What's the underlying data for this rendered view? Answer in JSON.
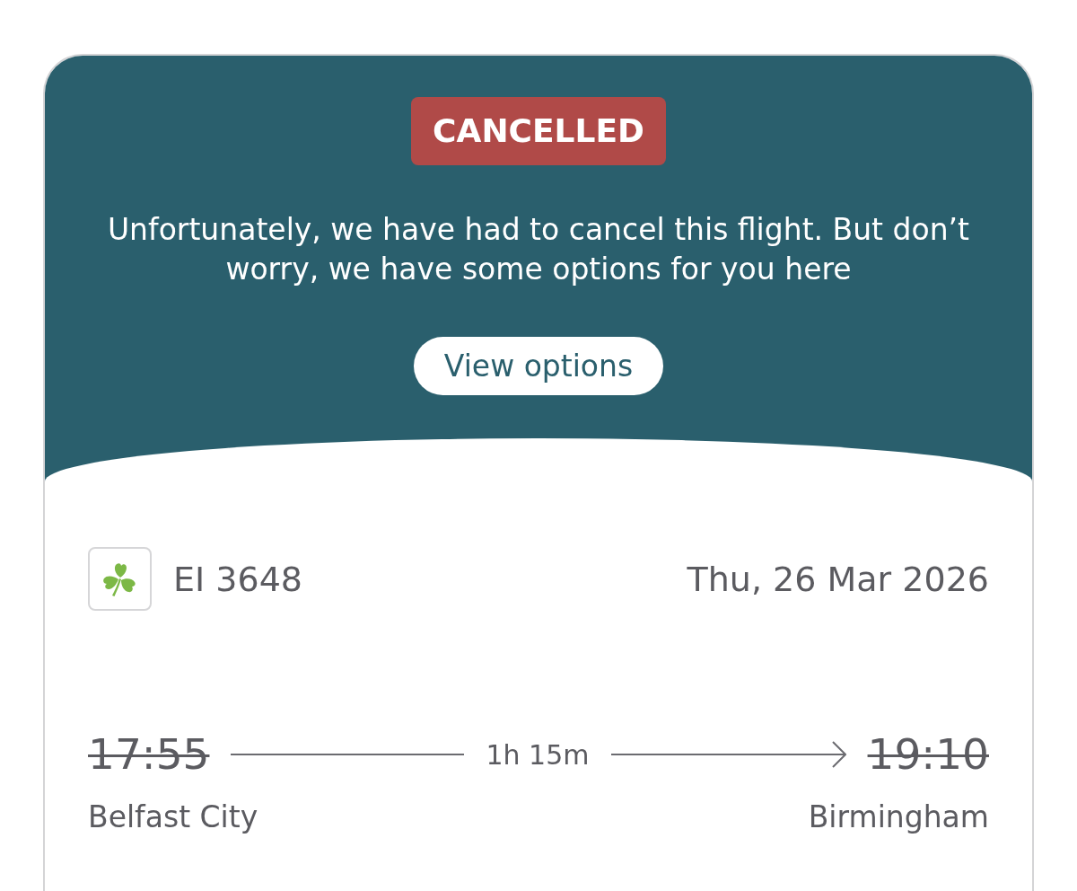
{
  "status_badge": {
    "text": "CANCELLED",
    "kind": "cancelled"
  },
  "message": "Unfortunately, we have had to cancel this flight. But don’t worry, we have some options for you here",
  "action_button": {
    "label": "View options"
  },
  "flight": {
    "number": "EI 3648",
    "date": "Thu, 26 Mar 2026"
  },
  "departure": {
    "time": "17:55",
    "place": "Belfast City",
    "struck": true
  },
  "duration": "1h 15m",
  "arrival": {
    "time": "19:10",
    "place": "Birmingham",
    "struck": true
  }
}
